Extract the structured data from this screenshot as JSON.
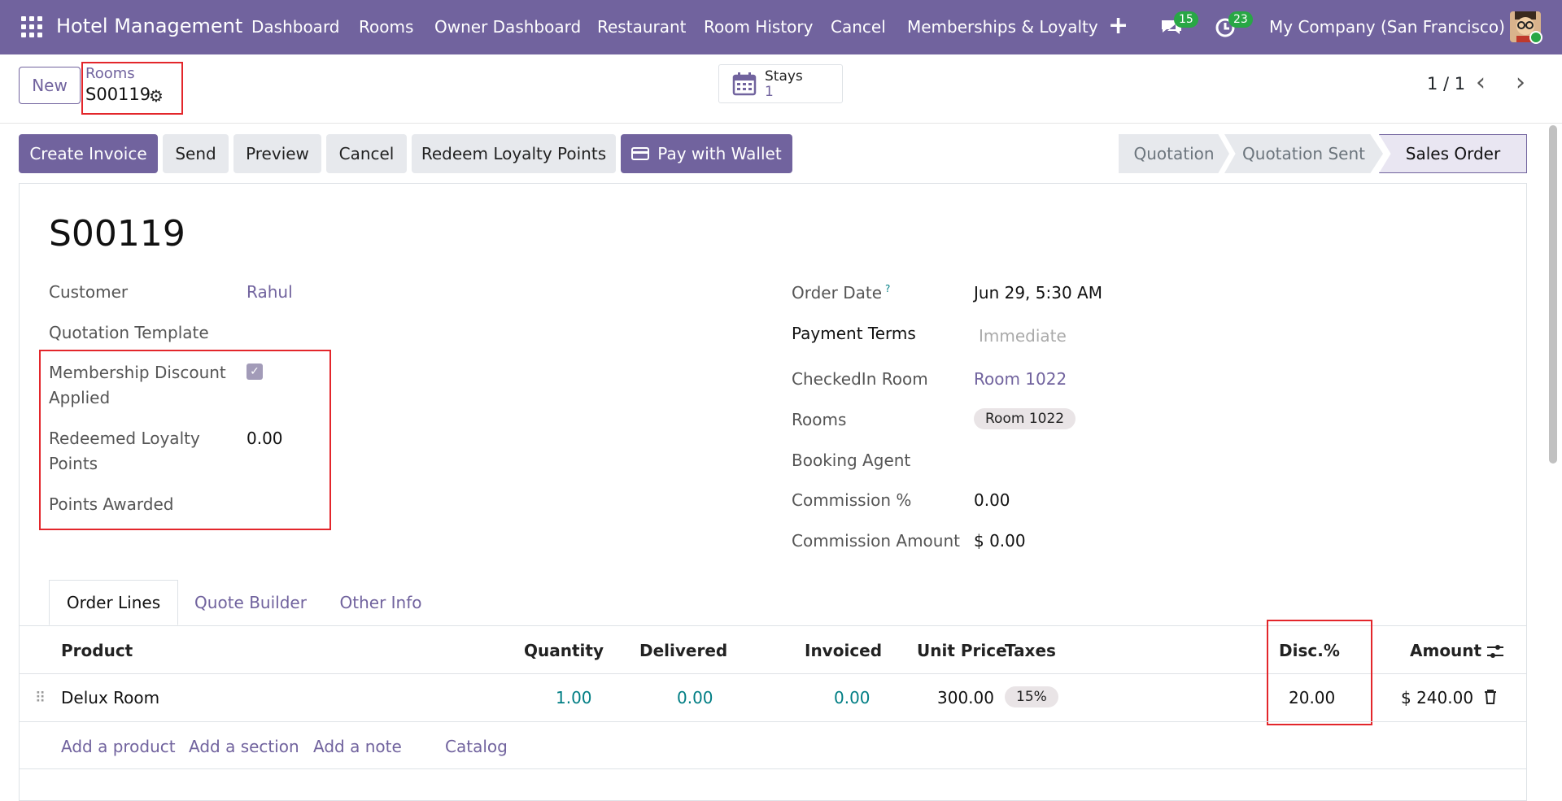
{
  "navbar": {
    "brand": "Hotel Management",
    "menu": [
      "Dashboard",
      "Rooms",
      "Owner Dashboard",
      "Restaurant",
      "Room History",
      "Cancel",
      "Memberships & Loyalty"
    ],
    "messages_count": "15",
    "activities_count": "23",
    "company": "My Company (San Francisco)",
    "accent": "#71639e"
  },
  "control": {
    "new_label": "New",
    "breadcrumb_parent": "Rooms",
    "breadcrumb_current": "S00119",
    "stays_label": "Stays",
    "stays_count": "1",
    "pager": "1 / 1"
  },
  "actions": {
    "create_invoice": "Create Invoice",
    "send": "Send",
    "preview": "Preview",
    "cancel": "Cancel",
    "redeem": "Redeem Loyalty Points",
    "wallet": "Pay with Wallet"
  },
  "statusbar": [
    "Quotation",
    "Quotation Sent",
    "Sales Order"
  ],
  "form": {
    "title": "S00119",
    "left": {
      "customer_label": "Customer",
      "customer_value": "Rahul",
      "template_label": "Quotation Template",
      "membership_label_1": "Membership Discount",
      "membership_label_2": "Applied",
      "membership_checked": true,
      "redeemed_label_1": "Redeemed Loyalty",
      "redeemed_label_2": "Points",
      "redeemed_value": "0.00",
      "awarded_label": "Points Awarded"
    },
    "right": {
      "order_date_label": "Order Date",
      "order_date_help": "?",
      "order_date_value": "Jun 29, 5:30 AM",
      "payment_terms_label": "Payment Terms",
      "payment_terms_placeholder": "Immediate",
      "checkin_label": "CheckedIn Room",
      "checkin_value": "Room 1022",
      "rooms_label": "Rooms",
      "rooms_tag": "Room 1022",
      "agent_label": "Booking Agent",
      "commission_pct_label": "Commission %",
      "commission_pct_value": "0.00",
      "commission_amt_label": "Commission Amount",
      "commission_amt_value": "$ 0.00"
    }
  },
  "tabs": [
    "Order Lines",
    "Quote Builder",
    "Other Info"
  ],
  "table": {
    "headers": {
      "product": "Product",
      "quantity": "Quantity",
      "delivered": "Delivered",
      "invoiced": "Invoiced",
      "unit_price": "Unit Price",
      "taxes": "Taxes",
      "disc": "Disc.%",
      "amount": "Amount"
    },
    "row": {
      "product": "Delux Room",
      "quantity": "1.00",
      "delivered": "0.00",
      "invoiced": "0.00",
      "unit_price": "300.00",
      "taxes": "15%",
      "disc": "20.00",
      "amount": "$ 240.00"
    },
    "add_links": [
      "Add a product",
      "Add a section",
      "Add a note",
      "Catalog"
    ]
  }
}
